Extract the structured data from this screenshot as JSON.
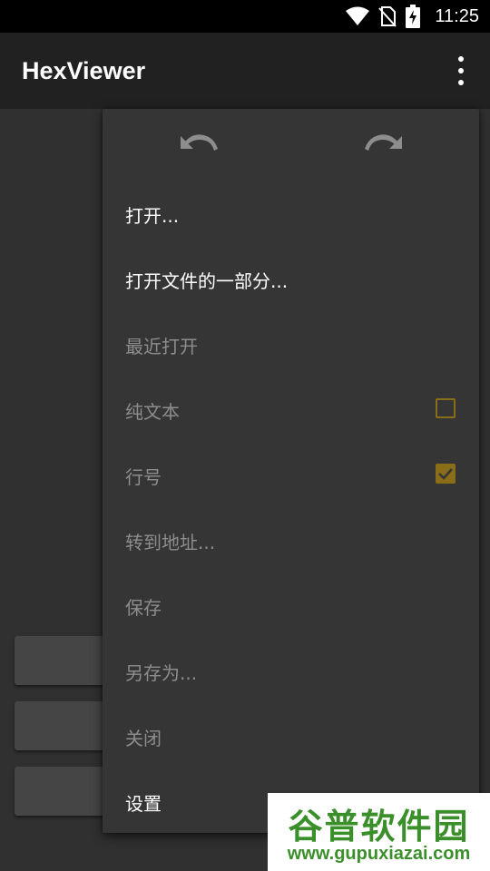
{
  "status_bar": {
    "time": "11:25"
  },
  "app_bar": {
    "title": "HexViewer"
  },
  "menu": {
    "items": [
      {
        "label": "打开...",
        "enabled": true
      },
      {
        "label": "打开文件的一部分...",
        "enabled": true
      },
      {
        "label": "最近打开",
        "enabled": false
      },
      {
        "label": "纯文本",
        "enabled": false,
        "checkbox": false
      },
      {
        "label": "行号",
        "enabled": false,
        "checkbox": true
      },
      {
        "label": "转到地址...",
        "enabled": false
      },
      {
        "label": "保存",
        "enabled": false
      },
      {
        "label": "另存为...",
        "enabled": false
      },
      {
        "label": "关闭",
        "enabled": false
      },
      {
        "label": "设置",
        "enabled": true
      }
    ]
  },
  "watermark": {
    "title": "谷普软件园",
    "url": "www.gupuxiazai.com"
  },
  "colors": {
    "accent": "#8a6d18",
    "app_bar": "#212121",
    "menu": "#353535",
    "watermark_green": "#3a8f2a"
  },
  "icons": [
    "wifi-icon",
    "no-sim-icon",
    "battery-charging-icon",
    "overflow-menu-icon",
    "undo-icon",
    "redo-icon",
    "checkbox-icon"
  ]
}
